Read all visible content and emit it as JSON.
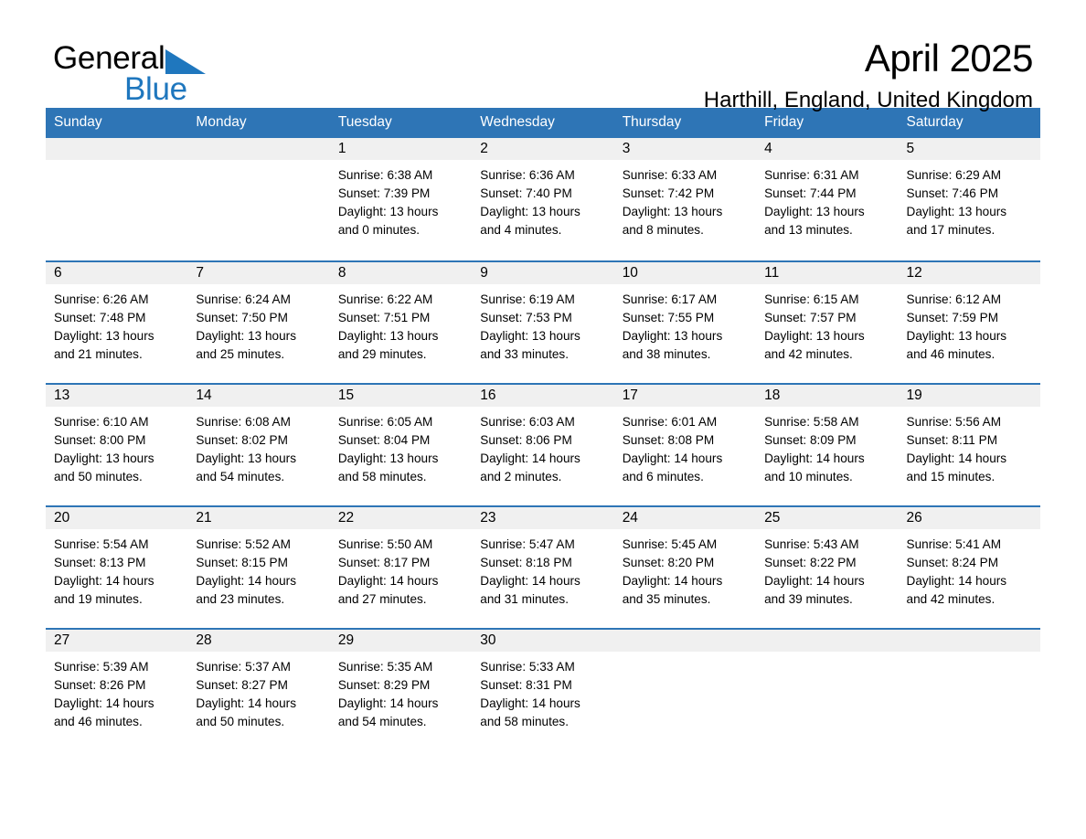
{
  "brand": {
    "logo_line1": "General",
    "logo_line2": "Blue",
    "logo_triangle_icon": "triangle-icon",
    "accent_color": "#2E75B6",
    "logo_blue": "#1F77BE"
  },
  "header": {
    "month_title": "April 2025",
    "location": "Harthill, England, United Kingdom"
  },
  "calendar": {
    "weekday_headers": [
      "Sunday",
      "Monday",
      "Tuesday",
      "Wednesday",
      "Thursday",
      "Friday",
      "Saturday"
    ],
    "weeks": [
      [
        {
          "day": "",
          "sunrise": "",
          "sunset": "",
          "daylight1": "",
          "daylight2": "",
          "blank": true
        },
        {
          "day": "",
          "sunrise": "",
          "sunset": "",
          "daylight1": "",
          "daylight2": "",
          "blank": true
        },
        {
          "day": "1",
          "sunrise": "Sunrise: 6:38 AM",
          "sunset": "Sunset: 7:39 PM",
          "daylight1": "Daylight: 13 hours",
          "daylight2": "and 0 minutes."
        },
        {
          "day": "2",
          "sunrise": "Sunrise: 6:36 AM",
          "sunset": "Sunset: 7:40 PM",
          "daylight1": "Daylight: 13 hours",
          "daylight2": "and 4 minutes."
        },
        {
          "day": "3",
          "sunrise": "Sunrise: 6:33 AM",
          "sunset": "Sunset: 7:42 PM",
          "daylight1": "Daylight: 13 hours",
          "daylight2": "and 8 minutes."
        },
        {
          "day": "4",
          "sunrise": "Sunrise: 6:31 AM",
          "sunset": "Sunset: 7:44 PM",
          "daylight1": "Daylight: 13 hours",
          "daylight2": "and 13 minutes."
        },
        {
          "day": "5",
          "sunrise": "Sunrise: 6:29 AM",
          "sunset": "Sunset: 7:46 PM",
          "daylight1": "Daylight: 13 hours",
          "daylight2": "and 17 minutes."
        }
      ],
      [
        {
          "day": "6",
          "sunrise": "Sunrise: 6:26 AM",
          "sunset": "Sunset: 7:48 PM",
          "daylight1": "Daylight: 13 hours",
          "daylight2": "and 21 minutes."
        },
        {
          "day": "7",
          "sunrise": "Sunrise: 6:24 AM",
          "sunset": "Sunset: 7:50 PM",
          "daylight1": "Daylight: 13 hours",
          "daylight2": "and 25 minutes."
        },
        {
          "day": "8",
          "sunrise": "Sunrise: 6:22 AM",
          "sunset": "Sunset: 7:51 PM",
          "daylight1": "Daylight: 13 hours",
          "daylight2": "and 29 minutes."
        },
        {
          "day": "9",
          "sunrise": "Sunrise: 6:19 AM",
          "sunset": "Sunset: 7:53 PM",
          "daylight1": "Daylight: 13 hours",
          "daylight2": "and 33 minutes."
        },
        {
          "day": "10",
          "sunrise": "Sunrise: 6:17 AM",
          "sunset": "Sunset: 7:55 PM",
          "daylight1": "Daylight: 13 hours",
          "daylight2": "and 38 minutes."
        },
        {
          "day": "11",
          "sunrise": "Sunrise: 6:15 AM",
          "sunset": "Sunset: 7:57 PM",
          "daylight1": "Daylight: 13 hours",
          "daylight2": "and 42 minutes."
        },
        {
          "day": "12",
          "sunrise": "Sunrise: 6:12 AM",
          "sunset": "Sunset: 7:59 PM",
          "daylight1": "Daylight: 13 hours",
          "daylight2": "and 46 minutes."
        }
      ],
      [
        {
          "day": "13",
          "sunrise": "Sunrise: 6:10 AM",
          "sunset": "Sunset: 8:00 PM",
          "daylight1": "Daylight: 13 hours",
          "daylight2": "and 50 minutes."
        },
        {
          "day": "14",
          "sunrise": "Sunrise: 6:08 AM",
          "sunset": "Sunset: 8:02 PM",
          "daylight1": "Daylight: 13 hours",
          "daylight2": "and 54 minutes."
        },
        {
          "day": "15",
          "sunrise": "Sunrise: 6:05 AM",
          "sunset": "Sunset: 8:04 PM",
          "daylight1": "Daylight: 13 hours",
          "daylight2": "and 58 minutes."
        },
        {
          "day": "16",
          "sunrise": "Sunrise: 6:03 AM",
          "sunset": "Sunset: 8:06 PM",
          "daylight1": "Daylight: 14 hours",
          "daylight2": "and 2 minutes."
        },
        {
          "day": "17",
          "sunrise": "Sunrise: 6:01 AM",
          "sunset": "Sunset: 8:08 PM",
          "daylight1": "Daylight: 14 hours",
          "daylight2": "and 6 minutes."
        },
        {
          "day": "18",
          "sunrise": "Sunrise: 5:58 AM",
          "sunset": "Sunset: 8:09 PM",
          "daylight1": "Daylight: 14 hours",
          "daylight2": "and 10 minutes."
        },
        {
          "day": "19",
          "sunrise": "Sunrise: 5:56 AM",
          "sunset": "Sunset: 8:11 PM",
          "daylight1": "Daylight: 14 hours",
          "daylight2": "and 15 minutes."
        }
      ],
      [
        {
          "day": "20",
          "sunrise": "Sunrise: 5:54 AM",
          "sunset": "Sunset: 8:13 PM",
          "daylight1": "Daylight: 14 hours",
          "daylight2": "and 19 minutes."
        },
        {
          "day": "21",
          "sunrise": "Sunrise: 5:52 AM",
          "sunset": "Sunset: 8:15 PM",
          "daylight1": "Daylight: 14 hours",
          "daylight2": "and 23 minutes."
        },
        {
          "day": "22",
          "sunrise": "Sunrise: 5:50 AM",
          "sunset": "Sunset: 8:17 PM",
          "daylight1": "Daylight: 14 hours",
          "daylight2": "and 27 minutes."
        },
        {
          "day": "23",
          "sunrise": "Sunrise: 5:47 AM",
          "sunset": "Sunset: 8:18 PM",
          "daylight1": "Daylight: 14 hours",
          "daylight2": "and 31 minutes."
        },
        {
          "day": "24",
          "sunrise": "Sunrise: 5:45 AM",
          "sunset": "Sunset: 8:20 PM",
          "daylight1": "Daylight: 14 hours",
          "daylight2": "and 35 minutes."
        },
        {
          "day": "25",
          "sunrise": "Sunrise: 5:43 AM",
          "sunset": "Sunset: 8:22 PM",
          "daylight1": "Daylight: 14 hours",
          "daylight2": "and 39 minutes."
        },
        {
          "day": "26",
          "sunrise": "Sunrise: 5:41 AM",
          "sunset": "Sunset: 8:24 PM",
          "daylight1": "Daylight: 14 hours",
          "daylight2": "and 42 minutes."
        }
      ],
      [
        {
          "day": "27",
          "sunrise": "Sunrise: 5:39 AM",
          "sunset": "Sunset: 8:26 PM",
          "daylight1": "Daylight: 14 hours",
          "daylight2": "and 46 minutes."
        },
        {
          "day": "28",
          "sunrise": "Sunrise: 5:37 AM",
          "sunset": "Sunset: 8:27 PM",
          "daylight1": "Daylight: 14 hours",
          "daylight2": "and 50 minutes."
        },
        {
          "day": "29",
          "sunrise": "Sunrise: 5:35 AM",
          "sunset": "Sunset: 8:29 PM",
          "daylight1": "Daylight: 14 hours",
          "daylight2": "and 54 minutes."
        },
        {
          "day": "30",
          "sunrise": "Sunrise: 5:33 AM",
          "sunset": "Sunset: 8:31 PM",
          "daylight1": "Daylight: 14 hours",
          "daylight2": "and 58 minutes."
        },
        {
          "day": "",
          "sunrise": "",
          "sunset": "",
          "daylight1": "",
          "daylight2": "",
          "blank": true
        },
        {
          "day": "",
          "sunrise": "",
          "sunset": "",
          "daylight1": "",
          "daylight2": "",
          "blank": true
        },
        {
          "day": "",
          "sunrise": "",
          "sunset": "",
          "daylight1": "",
          "daylight2": "",
          "blank": true
        }
      ]
    ]
  }
}
